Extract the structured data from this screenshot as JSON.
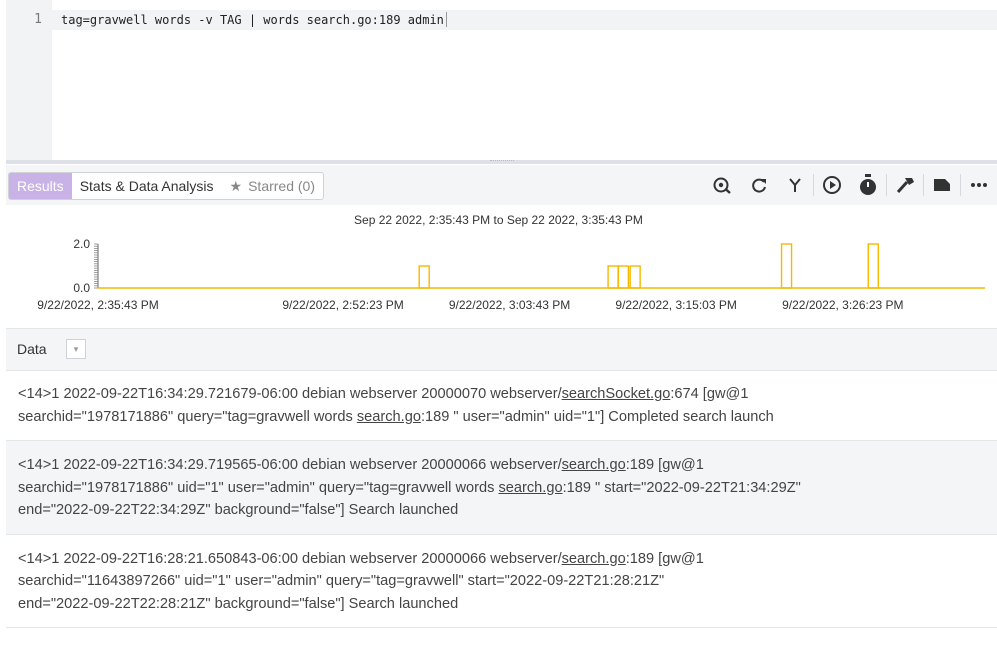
{
  "editor": {
    "line_number": "1",
    "query": "tag=gravwell words -v TAG | words search.go:189 admin"
  },
  "tabs": {
    "results": "Results",
    "stats": "Stats & Data Analysis",
    "starred": "Starred (0)"
  },
  "toolbar_icons": [
    "scope-search-icon",
    "refresh-icon",
    "fork-icon",
    "play-icon",
    "timer-icon",
    "hammer-icon",
    "label-icon",
    "more-icon"
  ],
  "chart_data": {
    "type": "bar",
    "title": "Sep 22 2022, 2:35:43 PM to Sep 22 2022, 3:35:43 PM",
    "y_ticks": [
      "2.0",
      "0.0"
    ],
    "x_tick_labels": [
      "9/22/2022, 2:35:43 PM",
      "9/22/2022, 2:52:23 PM",
      "9/22/2022, 3:03:43 PM",
      "9/22/2022, 3:15:03 PM",
      "9/22/2022, 3:26:23 PM"
    ],
    "x_range": [
      0,
      60
    ],
    "ylim": [
      0,
      2
    ],
    "buckets_minutes": [
      21.85,
      34.7,
      35.4,
      36.2,
      46.5,
      52.4
    ],
    "values": [
      1,
      1,
      1,
      1,
      2,
      2
    ],
    "color": "#f5b800"
  },
  "data_section": {
    "label": "Data",
    "dropdown_glyph": "▾"
  },
  "entries": [
    {
      "line1_a": "<14>1 2022-09-22T16:34:29.721679-06:00 debian webserver 20000070 webserver/",
      "line1_link": "searchSocket.go",
      "line1_b": ":674 [gw@1",
      "line2_a": "searchid=\"1978171886\" query=\"tag=gravwell words ",
      "line2_link": "search.go",
      "line2_b": ":189 \" user=\"admin\" uid=\"1\"] Completed search launch",
      "line3": ""
    },
    {
      "line1_a": "<14>1 2022-09-22T16:34:29.719565-06:00 debian webserver 20000066 webserver/",
      "line1_link": "search.go",
      "line1_b": ":189 [gw@1",
      "line2_a": "searchid=\"1978171886\" uid=\"1\" user=\"admin\" query=\"tag=gravwell words ",
      "line2_link": "search.go",
      "line2_b": ":189 \" start=\"2022-09-22T21:34:29Z\"",
      "line3": "end=\"2022-09-22T22:34:29Z\" background=\"false\"] Search launched"
    },
    {
      "line1_a": "<14>1 2022-09-22T16:28:21.650843-06:00 debian webserver 20000066 webserver/",
      "line1_link": "search.go",
      "line1_b": ":189 [gw@1",
      "line2_a": "searchid=\"11643897266\" uid=\"1\" user=\"admin\" query=\"tag=gravwell\" start=\"2022-09-22T21:28:21Z\"",
      "line2_link": "",
      "line2_b": "",
      "line3": "end=\"2022-09-22T22:28:21Z\" background=\"false\"] Search launched"
    }
  ]
}
